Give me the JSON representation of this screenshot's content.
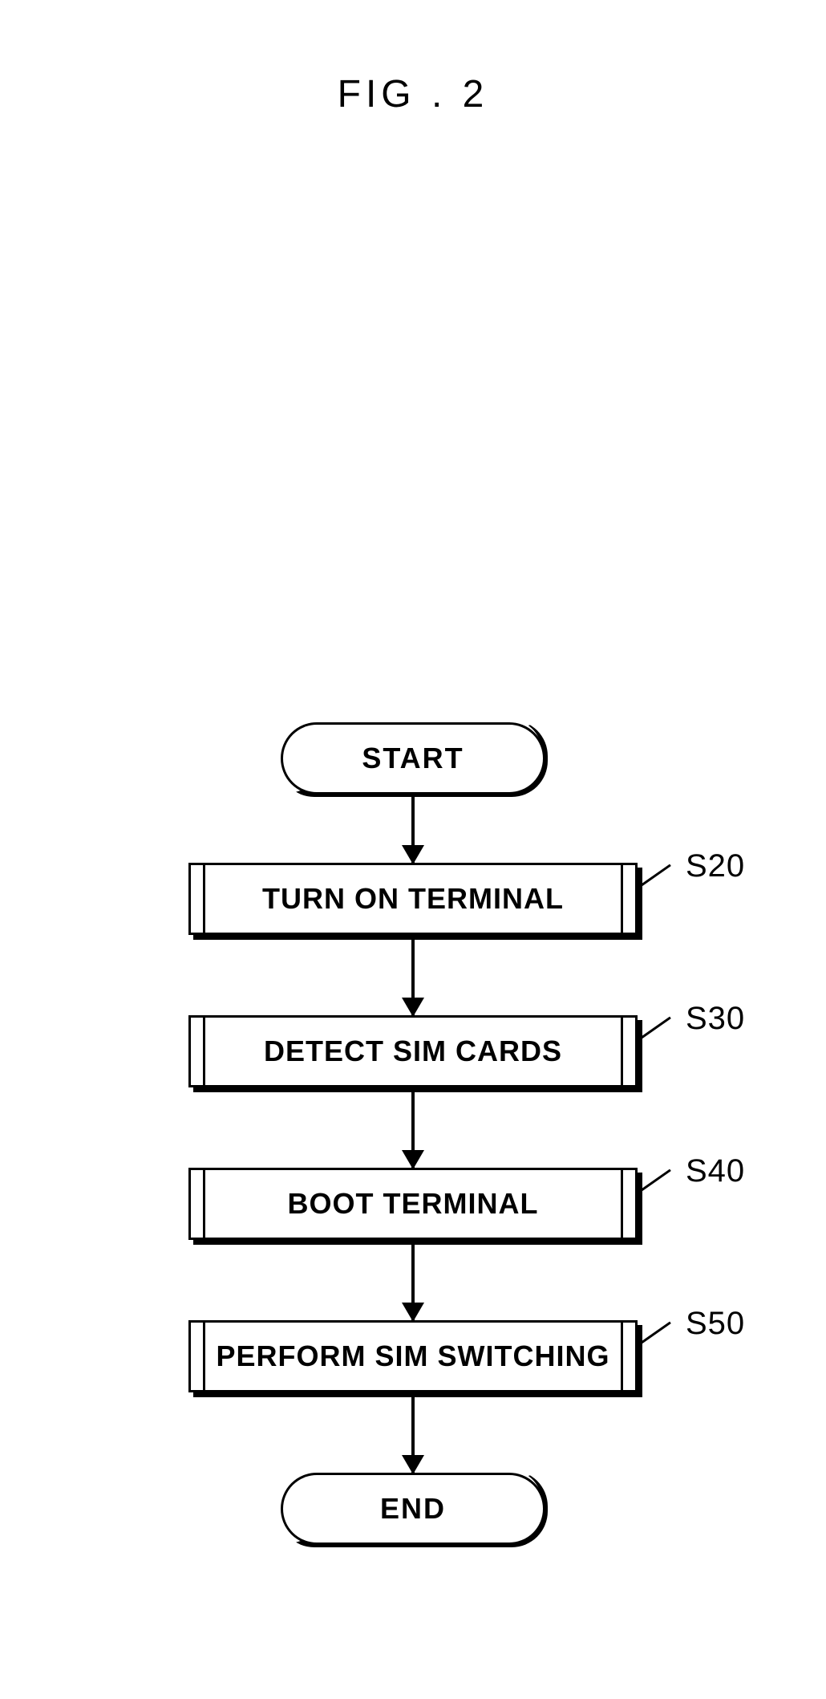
{
  "figure_title": "FIG . 2",
  "flowchart": {
    "start": "START",
    "end": "END",
    "steps": [
      {
        "text": "TURN ON TERMINAL",
        "label": "S20"
      },
      {
        "text": "DETECT SIM CARDS",
        "label": "S30"
      },
      {
        "text": "BOOT TERMINAL",
        "label": "S40"
      },
      {
        "text": "PERFORM SIM SWITCHING",
        "label": "S50"
      }
    ]
  }
}
